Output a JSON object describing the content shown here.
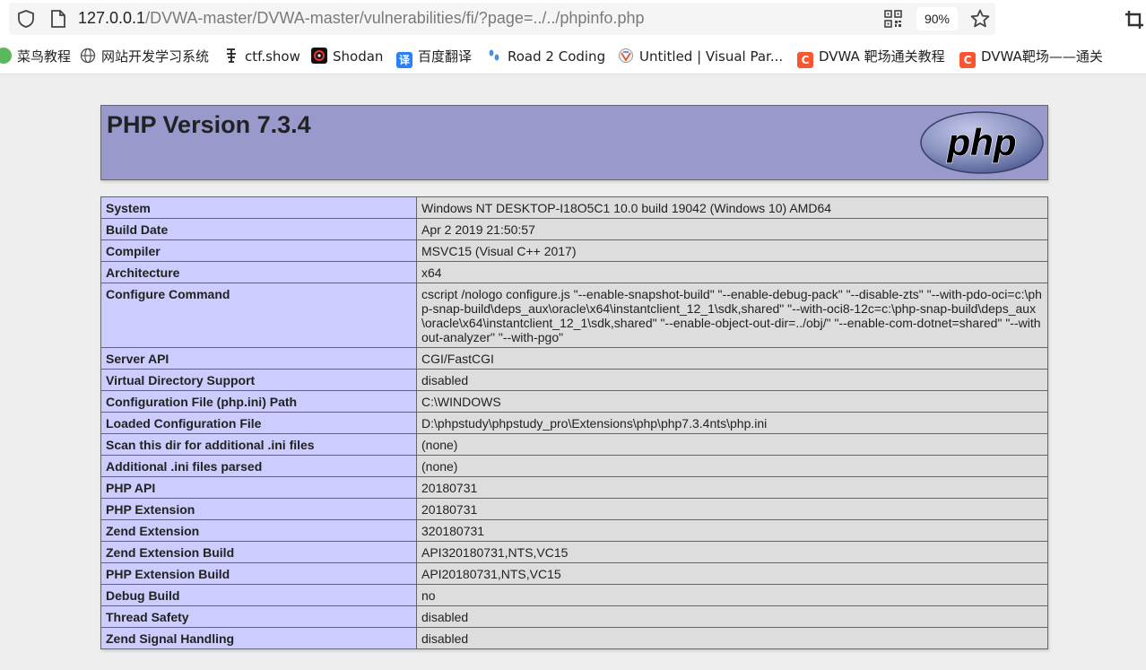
{
  "browser": {
    "url_host": "127.0.0.1",
    "url_path": "/DVWA-master/DVWA-master/vulnerabilities/fi/?page=../../phpinfo.php",
    "zoom": "90%",
    "bookmarks": [
      {
        "label": "菜鸟教程",
        "icon": "runoob-icon",
        "color": "#5cb85c"
      },
      {
        "label": "网站开发学习系统",
        "icon": "globe-icon",
        "color": "#555555"
      },
      {
        "label": "ctf.show",
        "icon": "ctfshow-icon",
        "color": "#222222"
      },
      {
        "label": "Shodan",
        "icon": "shodan-icon",
        "color": "#b80000"
      },
      {
        "label": "百度翻译",
        "icon": "baidu-translate-icon",
        "color": "#2d7ff9",
        "glyph": "译"
      },
      {
        "label": "Road 2 Coding",
        "icon": "feet-icon",
        "color": "#4a90d9"
      },
      {
        "label": "Untitled | Visual Par...",
        "icon": "visual-paradigm-icon",
        "color": "#e05a3a"
      },
      {
        "label": "DVWA 靶场通关教程",
        "icon": "csdn-icon",
        "color": "#fc5531",
        "glyph": "C"
      },
      {
        "label": "DVWA靶场——通关",
        "icon": "csdn-icon",
        "color": "#fc5531",
        "glyph": "C"
      }
    ]
  },
  "phpinfo": {
    "title": "PHP Version 7.3.4",
    "logo_text": "php",
    "rows": [
      {
        "key": "System",
        "value": "Windows NT DESKTOP-I18O5C1 10.0 build 19042 (Windows 10) AMD64"
      },
      {
        "key": "Build Date",
        "value": "Apr 2 2019 21:50:57"
      },
      {
        "key": "Compiler",
        "value": "MSVC15 (Visual C++ 2017)"
      },
      {
        "key": "Architecture",
        "value": "x64"
      },
      {
        "key": "Configure Command",
        "value": "cscript /nologo configure.js \"--enable-snapshot-build\" \"--enable-debug-pack\" \"--disable-zts\" \"--with-pdo-oci=c:\\php-snap-build\\deps_aux\\oracle\\x64\\instantclient_12_1\\sdk,shared\" \"--with-oci8-12c=c:\\php-snap-build\\deps_aux\\oracle\\x64\\instantclient_12_1\\sdk,shared\" \"--enable-object-out-dir=../obj/\" \"--enable-com-dotnet=shared\" \"--without-analyzer\" \"--with-pgo\""
      },
      {
        "key": "Server API",
        "value": "CGI/FastCGI"
      },
      {
        "key": "Virtual Directory Support",
        "value": "disabled"
      },
      {
        "key": "Configuration File (php.ini) Path",
        "value": "C:\\WINDOWS"
      },
      {
        "key": "Loaded Configuration File",
        "value": "D:\\phpstudy\\phpstudy_pro\\Extensions\\php\\php7.3.4nts\\php.ini"
      },
      {
        "key": "Scan this dir for additional .ini files",
        "value": "(none)"
      },
      {
        "key": "Additional .ini files parsed",
        "value": "(none)"
      },
      {
        "key": "PHP API",
        "value": "20180731"
      },
      {
        "key": "PHP Extension",
        "value": "20180731"
      },
      {
        "key": "Zend Extension",
        "value": "320180731"
      },
      {
        "key": "Zend Extension Build",
        "value": "API320180731,NTS,VC15"
      },
      {
        "key": "PHP Extension Build",
        "value": "API20180731,NTS,VC15"
      },
      {
        "key": "Debug Build",
        "value": "no"
      },
      {
        "key": "Thread Safety",
        "value": "disabled"
      },
      {
        "key": "Zend Signal Handling",
        "value": "disabled"
      }
    ]
  },
  "colors": {
    "header_bg": "#9999cc",
    "key_bg": "#ccccff",
    "value_bg": "#dddddd",
    "page_bg": "#eeeeee"
  }
}
